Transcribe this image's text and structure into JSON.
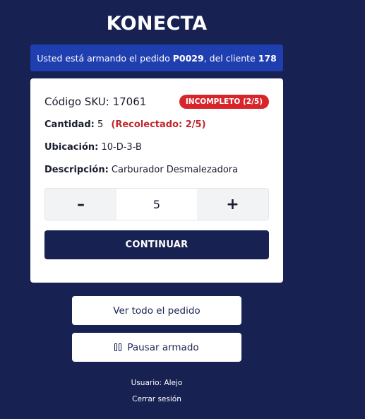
{
  "app": {
    "title": "KONECTA"
  },
  "banner": {
    "prefix": "Usted está armando el pedido ",
    "order_id": "P0029",
    "middle": ", del cliente ",
    "client_id": "178"
  },
  "item": {
    "sku_label": "Código SKU: 17061",
    "status_badge": "INCOMPLETO (2/5)",
    "status_color": "#d7262b",
    "quantity_label": "Cantidad:",
    "quantity_value": "5",
    "collected_text": "(Recolectado: 2/5)",
    "location_label": "Ubicación:",
    "location_value": "10-D-3-B",
    "description_label": "Descripción:",
    "description_value": "Carburador Desmalezadora"
  },
  "stepper": {
    "minus": "–",
    "value": "5",
    "plus": "+"
  },
  "actions": {
    "continue_label": "CONTINUAR",
    "view_order_label": "Ver todo el pedido",
    "pause_label": "Pausar armado",
    "pause_icon": "pause-icon"
  },
  "footer": {
    "user_text": "Usuario: Alejo",
    "logout_label": "Cerrar sesión"
  },
  "colors": {
    "background": "#172252",
    "banner": "#1f3fb0",
    "accent_red": "#c0262b"
  }
}
